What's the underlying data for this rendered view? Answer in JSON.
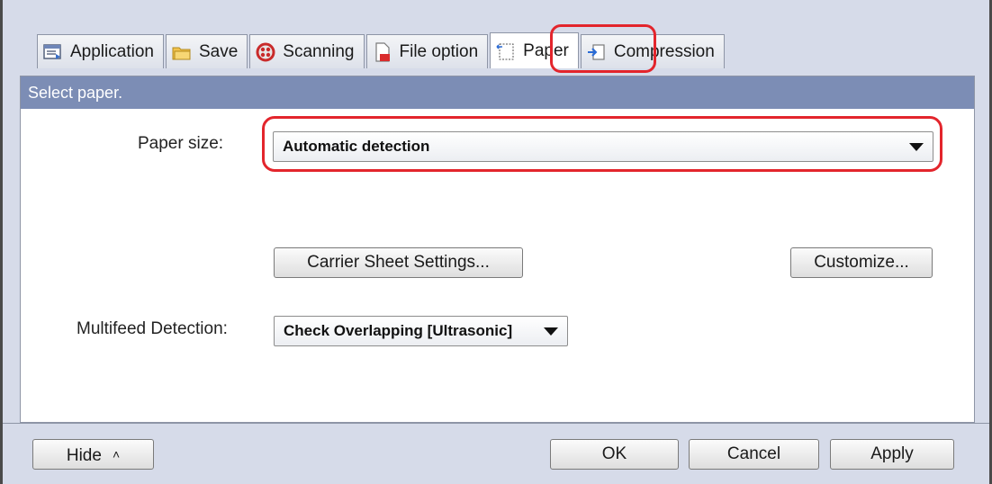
{
  "tabs": [
    {
      "label": "Application",
      "icon": "application-icon"
    },
    {
      "label": "Save",
      "icon": "folder-icon"
    },
    {
      "label": "Scanning",
      "icon": "scanning-icon"
    },
    {
      "label": "File option",
      "icon": "file-icon"
    },
    {
      "label": "Paper",
      "icon": "paper-icon",
      "active": true
    },
    {
      "label": "Compression",
      "icon": "compression-icon"
    }
  ],
  "panel": {
    "header": "Select paper.",
    "paper_size_label": "Paper size:",
    "paper_size_value": "Automatic detection",
    "carrier_sheet_button": "Carrier Sheet Settings...",
    "customize_button": "Customize...",
    "multifeed_label": "Multifeed Detection:",
    "multifeed_value": "Check Overlapping [Ultrasonic]"
  },
  "footer": {
    "hide_button": "Hide",
    "ok_button": "OK",
    "cancel_button": "Cancel",
    "apply_button": "Apply"
  },
  "colors": {
    "highlight": "#e3252c",
    "header_strip": "#7c8db5",
    "chrome": "#d6dbe9"
  }
}
